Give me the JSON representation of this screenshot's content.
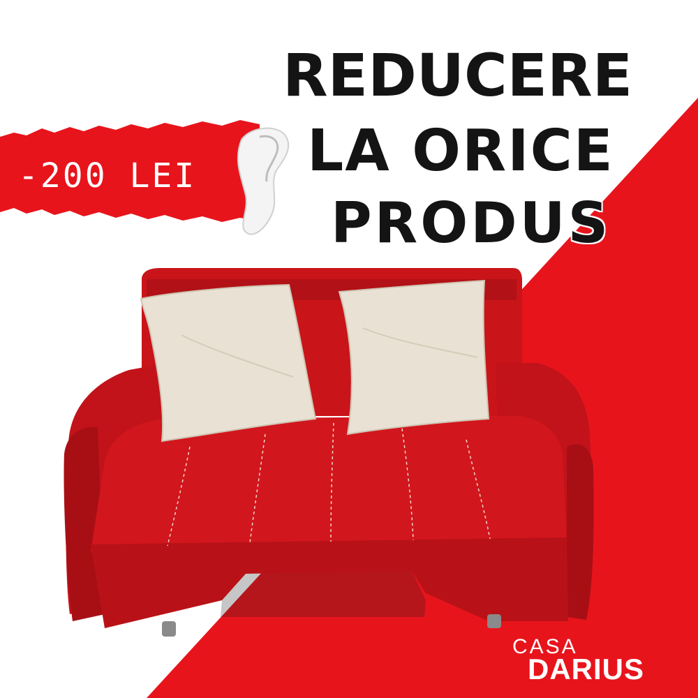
{
  "promo": {
    "discount": "-200 LEI",
    "headline_line1": "REDUCERE",
    "headline_line2": "LA ORICE",
    "headline_line3": "PRODUS"
  },
  "brand": {
    "logo_top": "CASA",
    "logo_bottom": "DARIUS"
  },
  "colors": {
    "accent_red": "#e8141c",
    "sofa_red": "#c9141a",
    "pillow_cream": "#e9e1d3",
    "text_dark": "#141414"
  },
  "product": {
    "image_subject": "sofa-with-two-pillows"
  }
}
